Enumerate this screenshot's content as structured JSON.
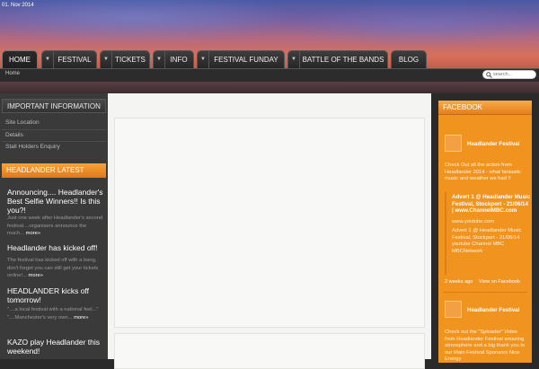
{
  "date": "01. Nov 2014",
  "nav": {
    "tabs": [
      {
        "label": "HOME",
        "active": true,
        "dropdown": false
      },
      {
        "label": "FESTIVAL",
        "active": false,
        "dropdown": true
      },
      {
        "label": "TICKETS",
        "active": false,
        "dropdown": true
      },
      {
        "label": "INFO",
        "active": false,
        "dropdown": true
      },
      {
        "label": "FESTIVAL FUNDAY",
        "active": false,
        "dropdown": true
      },
      {
        "label": "BATTLE OF THE BANDS",
        "active": false,
        "dropdown": true
      },
      {
        "label": "BLOG",
        "active": false,
        "dropdown": false
      }
    ],
    "dropdown_glyph": "▼"
  },
  "breadcrumb": "Home",
  "search": {
    "placeholder": "search..."
  },
  "left": {
    "important_title": "IMPORTANT INFORMATION",
    "important_links": [
      "Site Location",
      "Details",
      "Stall Holders Enquiry"
    ],
    "latest_title": "HEADLANDER LATEST",
    "more_label": "more»",
    "posts": [
      {
        "title": "Announcing.... Headlander's Best Selfie Winners!! Is this you?!",
        "excerpt": "Just one week after Headlander's second festival....organisers announce the much..."
      },
      {
        "title": "Headlander has kicked off!",
        "excerpt": "The festival has kicked off with a bang, don't forget you can still get your tickets online!..."
      },
      {
        "title": "HEADLANDER kicks off tomorrow!",
        "excerpt": "\"....a local festival with a national feel...\" \"....Manchester's very own..."
      },
      {
        "title": "KAZO play Headlander this weekend!",
        "excerpt": ""
      }
    ]
  },
  "facebook": {
    "title": "FACEBOOK",
    "page_name": "Headlander Festival",
    "post1": {
      "text": "Check Out all the action from Headlander 2014 - what fantastic music and weather we had !!",
      "link_title": "Advert 1 @ Headlander Music Festival, Stockport - 21/06/14 | www.ChannelMBC.com",
      "link_url": "www.youtube.com",
      "link_body": "Advert 1 @ Headlander Music Festival, Stockport - 21/06/14 youtube Channel MBC MBCNetwork",
      "time": "2 weeks ago",
      "view": "View on Facebook"
    },
    "post2": {
      "text": "Check out the \"Sploader\" Video from Headlander Festival amazing atmosphere and a big thank you to our Main Festival Sponsors Nice Energy"
    }
  },
  "colors": {
    "accent": "#f0941f",
    "dark": "#3a3a3a",
    "content_bg": "#f4f4f2"
  }
}
